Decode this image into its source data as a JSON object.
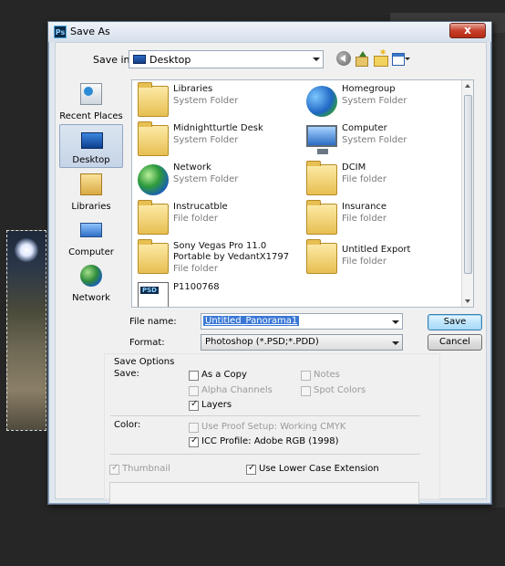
{
  "window": {
    "title": "Save As",
    "app_icon": "Ps",
    "close_label": "x"
  },
  "save_in": {
    "label": "Save in:",
    "value": "Desktop"
  },
  "toolbar": {
    "icons": [
      "back-icon",
      "up-folder-icon",
      "new-folder-icon",
      "view-menu-icon"
    ]
  },
  "places": [
    {
      "label": "Recent Places",
      "icon": "recent-places-icon"
    },
    {
      "label": "Desktop",
      "icon": "desktop-icon",
      "selected": true
    },
    {
      "label": "Libraries",
      "icon": "libraries-icon"
    },
    {
      "label": "Computer",
      "icon": "computer-icon"
    },
    {
      "label": "Network",
      "icon": "network-icon"
    }
  ],
  "files": [
    {
      "name": "Libraries",
      "type": "System Folder"
    },
    {
      "name": "Homegroup",
      "type": "System Folder"
    },
    {
      "name": "Midnightturtle Desk",
      "type": "System Folder"
    },
    {
      "name": "Computer",
      "type": "System Folder"
    },
    {
      "name": "Network",
      "type": "System Folder"
    },
    {
      "name": "DCIM",
      "type": "File folder"
    },
    {
      "name": "Instrucatble",
      "type": "File folder"
    },
    {
      "name": "Insurance",
      "type": "File folder"
    },
    {
      "name": "Sony Vegas Pro 11.0 Portable by VedantX1797",
      "type": "File folder"
    },
    {
      "name": "Untitled Export",
      "type": "File folder"
    },
    {
      "name": "P1100768",
      "type": ""
    }
  ],
  "file_name": {
    "label": "File name:",
    "value": "Untitled_Panorama1"
  },
  "format": {
    "label": "Format:",
    "value": "Photoshop (*.PSD;*.PDD)"
  },
  "buttons": {
    "save": "Save",
    "cancel": "Cancel"
  },
  "save_options": {
    "title": "Save Options",
    "save_label": "Save:",
    "as_a_copy": "As a Copy",
    "notes": "Notes",
    "alpha_channels": "Alpha Channels",
    "spot_colors": "Spot Colors",
    "layers": "Layers",
    "color_label": "Color:",
    "use_proof_setup": "Use Proof Setup:  Working CMYK",
    "icc_profile": "ICC Profile:  Adobe RGB (1998)",
    "thumbnail": "Thumbnail",
    "lower_case_ext": "Use Lower Case Extension"
  }
}
